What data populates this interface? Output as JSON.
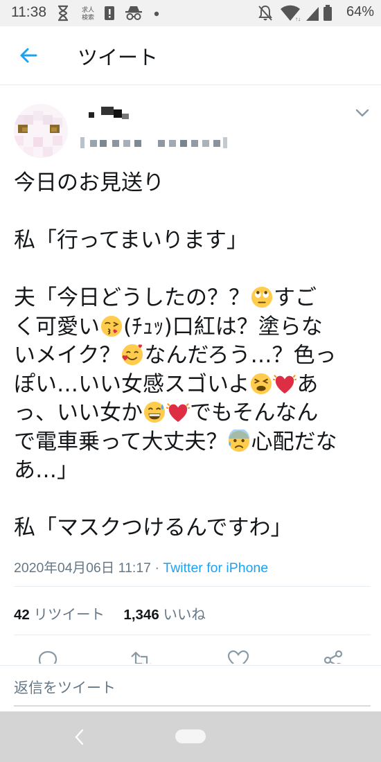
{
  "status_bar": {
    "time": "11:38",
    "battery": "64%",
    "notification_badge_text": "求人\n検索",
    "icons": [
      "hourglass-icon",
      "job-search-icon",
      "alert-icon",
      "incognito-icon",
      "dot-icon",
      "notifications-off-icon",
      "wifi-icon",
      "signal-icon",
      "battery-icon"
    ]
  },
  "header": {
    "title": "ツイート",
    "back_icon": "arrow-left-icon"
  },
  "tweet": {
    "lines": [
      [
        {
          "t": "今日のお見送り"
        }
      ],
      [],
      [
        {
          "t": "私「行ってまいります」"
        }
      ],
      [],
      [
        {
          "t": "夫「今日どうしたの？？"
        },
        {
          "e": "face-with-rolling-eyes"
        },
        {
          "t": "すご"
        }
      ],
      [
        {
          "t": "く可愛い"
        },
        {
          "e": "face-blowing-a-kiss"
        },
        {
          "t": "(ﾁｭｯ)口紅は？塗らな"
        }
      ],
      [
        {
          "t": "いメイク？"
        },
        {
          "e": "smiling-face-with-hearts"
        },
        {
          "t": "なんだろう…？色っ"
        }
      ],
      [
        {
          "t": "ぽい…いい女感スゴいよ"
        },
        {
          "e": "tired-face"
        },
        {
          "e": "beating-heart"
        },
        {
          "t": "あ"
        }
      ],
      [
        {
          "t": "っ、いい女か"
        },
        {
          "e": "grinning-face-with-sweat"
        },
        {
          "e": "beating-heart"
        },
        {
          "t": "でもそんなん"
        }
      ],
      [
        {
          "t": "で電車乗って大丈夫？"
        },
        {
          "e": "anxious-face-with-sweat"
        },
        {
          "t": "心配だな"
        }
      ],
      [
        {
          "t": "あ…」"
        }
      ],
      [],
      [
        {
          "t": "私「マスクつけるんですわ」"
        }
      ]
    ],
    "timestamp": "2020年04月06日 11:17",
    "separator": "·",
    "client": "Twitter for iPhone",
    "retweet_count": "42",
    "retweet_label": "リツイート",
    "like_count": "1,346",
    "like_label": "いいね",
    "action_icons": [
      "reply-icon",
      "retweet-icon",
      "like-icon",
      "share-icon"
    ],
    "menu_icon": "chevron-down-icon"
  },
  "reply": {
    "placeholder": "返信をツイート"
  },
  "nav_bar": {
    "icons": [
      "nav-back-icon",
      "home-pill-icon"
    ]
  },
  "colors": {
    "accent": "#1da1f2",
    "text": "#14171a",
    "secondary_text": "#657786",
    "emoji_red": "#dd2e44",
    "emoji_yellow": "#ffcc4d"
  }
}
